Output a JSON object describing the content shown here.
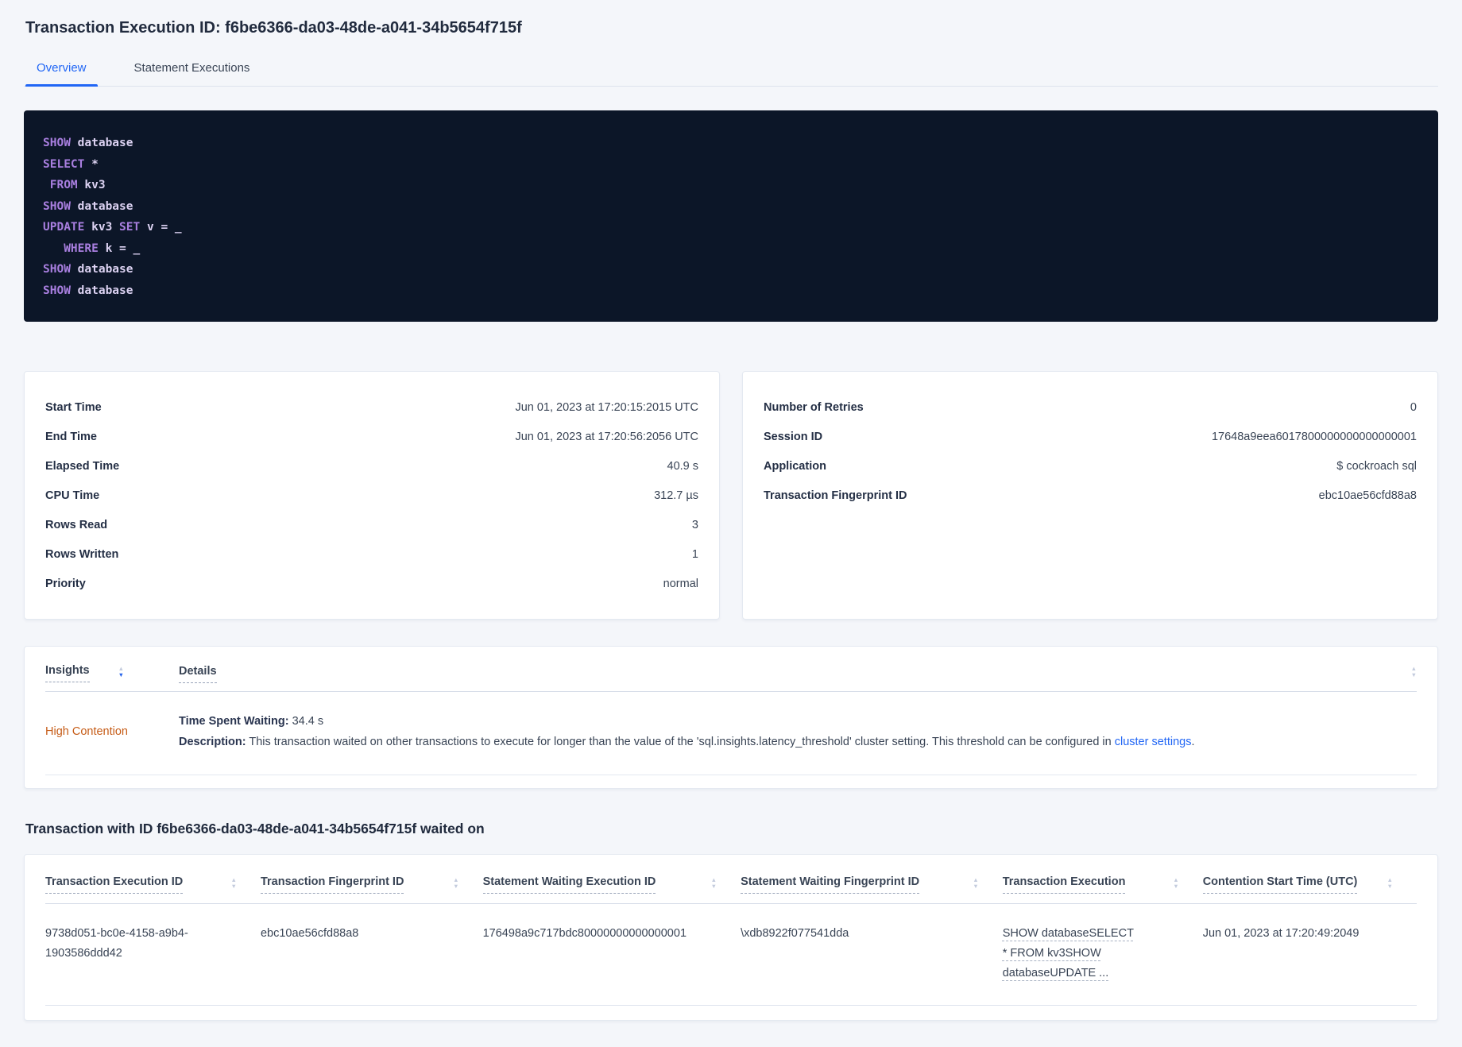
{
  "page": {
    "title": "Transaction Execution ID: f6be6366-da03-48de-a041-34b5654f715f",
    "tabs": [
      {
        "label": "Overview"
      },
      {
        "label": "Statement Executions"
      }
    ]
  },
  "colors": {
    "accent_blue": "#2166f5",
    "insight_orange": "#c65c17",
    "sql_background": "#0c1628",
    "sql_keyword": "#a97fe0",
    "sql_text": "#dcd2f2"
  },
  "sql": {
    "lines": [
      [
        "SHOW",
        " database"
      ],
      [
        "SELECT",
        " *"
      ],
      [
        " ",
        "FROM",
        " kv3"
      ],
      [
        "SHOW",
        " database"
      ],
      [
        "UPDATE",
        " kv3 ",
        "SET",
        " v = _"
      ],
      [
        "   ",
        "WHERE",
        " k = _"
      ],
      [
        "SHOW",
        " database"
      ],
      [
        "SHOW",
        " database"
      ]
    ]
  },
  "summary_left": {
    "rows": [
      {
        "label": "Start Time",
        "value": "Jun 01, 2023 at 17:20:15:2015 UTC"
      },
      {
        "label": "End Time",
        "value": "Jun 01, 2023 at 17:20:56:2056 UTC"
      },
      {
        "label": "Elapsed Time",
        "value": "40.9 s"
      },
      {
        "label": "CPU Time",
        "value": "312.7 µs"
      },
      {
        "label": "Rows Read",
        "value": "3"
      },
      {
        "label": "Rows Written",
        "value": "1"
      },
      {
        "label": "Priority",
        "value": "normal"
      }
    ]
  },
  "summary_right": {
    "rows": [
      {
        "label": "Number of Retries",
        "value": "0"
      },
      {
        "label": "Session ID",
        "value": "17648a9eea6017800000000000000001"
      },
      {
        "label": "Application",
        "value": "$ cockroach sql"
      },
      {
        "label": "Transaction Fingerprint ID",
        "value": "ebc10ae56cfd88a8"
      }
    ]
  },
  "insights": {
    "columns": [
      "Insights",
      "Details"
    ],
    "row": {
      "insight": "High Contention",
      "waiting_label": "Time Spent Waiting:",
      "waiting_value": " 34.4 s",
      "description_label": "Description:",
      "description_text": " This transaction waited on other transactions to execute for longer than the value of the 'sql.insights.latency_threshold' cluster setting. This threshold can be configured in ",
      "description_link": "cluster settings",
      "description_suffix": "."
    }
  },
  "waited": {
    "heading": "Transaction with ID f6be6366-da03-48de-a041-34b5654f715f waited on",
    "columns": [
      "Transaction Execution ID",
      "Transaction Fingerprint ID",
      "Statement Waiting Execution ID",
      "Statement Waiting Fingerprint ID",
      "Transaction Execution",
      "Contention Start Time (UTC)"
    ],
    "row": {
      "transaction_execution_id": "9738d051-bc0e-4158-a9b4-1903586ddd42",
      "transaction_fingerprint_id": "ebc10ae56cfd88a8",
      "statement_waiting_execution_id": "176498a9c717bdc80000000000000001",
      "statement_waiting_fingerprint_id": "\\xdb8922f077541dda",
      "transaction_execution": "SHOW databaseSELECT * FROM kv3SHOW databaseUPDATE ...",
      "contention_start_time": "Jun 01, 2023 at 17:20:49:2049"
    }
  }
}
